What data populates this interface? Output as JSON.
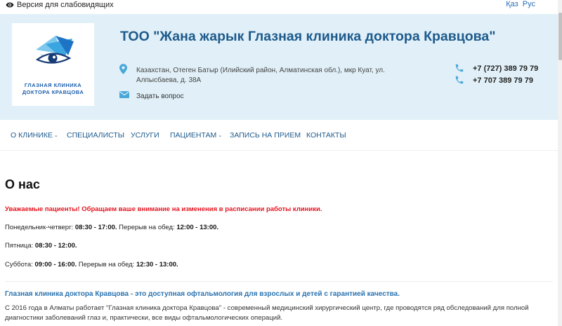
{
  "topbar": {
    "accessibility_label": "Версия для слабовидящих",
    "lang_kz": "Қаз",
    "lang_ru": "Рус"
  },
  "header": {
    "logo_line1": "ГЛАЗНАЯ КЛИНИКА",
    "logo_line2": "ДОКТОРА КРАВЦОВА",
    "title": "ТОО \"Жана жарык Глазная клиника доктора Кравцова\"",
    "address_line1": "Казахстан, Отеген Батыр (Илийский район, Алматинская обл.), мкр Куат, ул.",
    "address_line2": "Алпысбаева, д. 38А",
    "ask_question": "Задать вопрос",
    "phone1": "+7 (727) 389 79 79",
    "phone2": "+7 707 389 79 79"
  },
  "nav": {
    "items": [
      {
        "label": "О клинике",
        "dropdown": true
      },
      {
        "label": "Специалисты",
        "dropdown": false
      },
      {
        "label": "Услуги",
        "dropdown": false
      },
      {
        "label": "Пациентам",
        "dropdown": true
      },
      {
        "label": "Запись на прием",
        "dropdown": false
      },
      {
        "label": "Контакты",
        "dropdown": false
      }
    ],
    "caret": "⌄"
  },
  "content": {
    "title": "О нас",
    "notice": "Уважаемые пациенты! Обращаем ваше внимание на изменения в расписании работы клиники.",
    "hours": [
      {
        "label": "Понедельник-четверг: ",
        "time": "08:30 - 17:00.",
        "break_label": " Перерыв на обед: ",
        "break_time": "12:00 - 13:00."
      },
      {
        "label": "Пятница: ",
        "time": "08:30 - 12:00.",
        "break_label": "",
        "break_time": ""
      },
      {
        "label": "Суббота: ",
        "time": "09:00 - 16:00.",
        "break_label": " Перерыв на обед: ",
        "break_time": "12:30 - 13:00."
      }
    ],
    "tagline": "Глазная клиника доктора Кравцова  - это доступная офтальмология для взрослых и детей с гарантией качества.",
    "about": "С 2016 года в Алматы работает \"Глазная клиника доктора Кравцова\" - современный медицинский хирургический центр, где проводятся ряд обследований для полной диагностики заболеваний глаз и, практически, все виды офтальмологических операций."
  },
  "colors": {
    "header_bg": "#e1f0f8",
    "title": "#1e5a8c",
    "accent_icon": "#4aa8d8",
    "notice_red": "#e3141f",
    "link_blue": "#2a73b0"
  }
}
